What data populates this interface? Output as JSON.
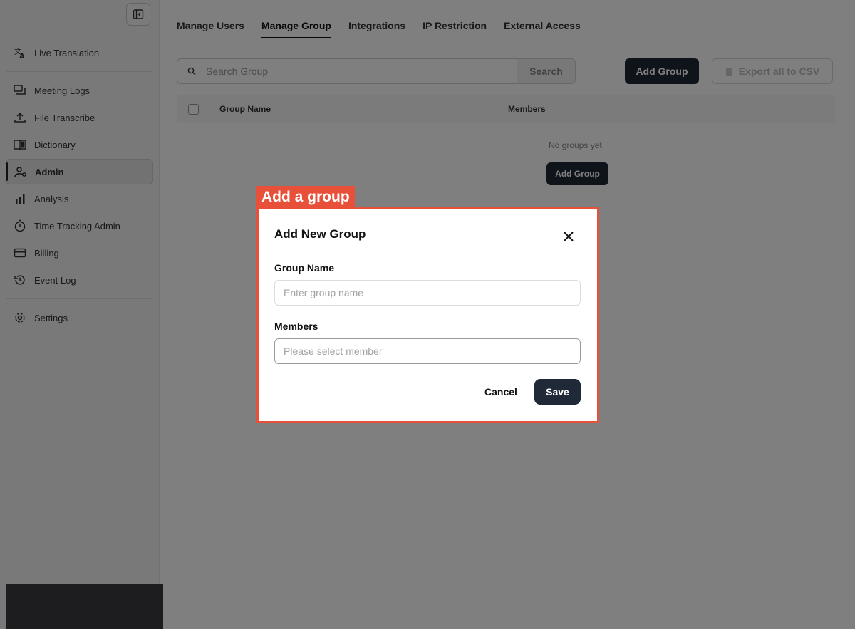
{
  "sidebar": {
    "items": [
      {
        "label": "Live Translation",
        "icon": "translate-icon"
      },
      {
        "label": "Meeting Logs",
        "icon": "chat-icon"
      },
      {
        "label": "File Transcribe",
        "icon": "upload-icon"
      },
      {
        "label": "Dictionary",
        "icon": "book-icon"
      },
      {
        "label": "Admin",
        "icon": "admin-icon",
        "active": true
      },
      {
        "label": "Analysis",
        "icon": "bar-chart-icon"
      },
      {
        "label": "Time Tracking Admin",
        "icon": "stopwatch-icon"
      },
      {
        "label": "Billing",
        "icon": "credit-card-icon"
      },
      {
        "label": "Event Log",
        "icon": "history-icon"
      },
      {
        "label": "Settings",
        "icon": "gear-icon"
      }
    ]
  },
  "tabs": [
    "Manage Users",
    "Manage Group",
    "Integrations",
    "IP Restriction",
    "External Access"
  ],
  "active_tab": "Manage Group",
  "toolbar": {
    "search_placeholder": "Search Group",
    "search_button": "Search",
    "add_group": "Add Group",
    "export": "Export all to CSV"
  },
  "table": {
    "columns": [
      "Group Name",
      "Members"
    ],
    "empty_text": "No groups yet.",
    "empty_action": "Add Group"
  },
  "annotation": {
    "label": "Add a group",
    "color": "#e8503a"
  },
  "modal": {
    "title": "Add New Group",
    "group_name_label": "Group Name",
    "group_name_placeholder": "Enter group name",
    "members_label": "Members",
    "members_placeholder": "Please select member",
    "cancel": "Cancel",
    "save": "Save"
  },
  "colors": {
    "primary": "#1f2937",
    "accent": "#e8503a"
  }
}
